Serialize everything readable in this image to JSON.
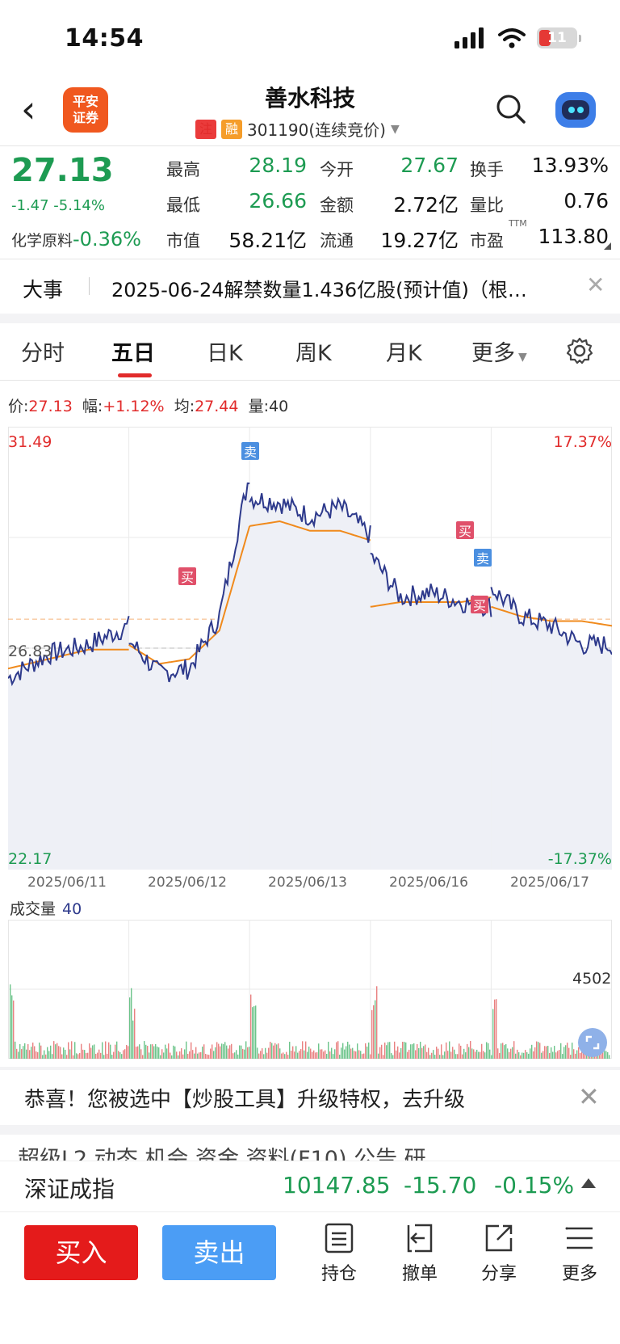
{
  "status": {
    "time": "14:54",
    "battery": "11"
  },
  "header": {
    "logo": [
      "平安",
      "证券"
    ],
    "name": "善水科技",
    "tag1": "注",
    "tag2": "融",
    "code": "301190(连续竞价)"
  },
  "quote": {
    "price": "27.13",
    "change": "-1.47 -5.14%",
    "industry_name": "化学原料",
    "industry_change": "-0.36%",
    "high_label": "最高",
    "high": "28.19",
    "open_label": "今开",
    "open": "27.67",
    "turnover_label": "换手",
    "turnover": "13.93%",
    "low_label": "最低",
    "low": "26.66",
    "amount_label": "金额",
    "amount": "2.72亿",
    "vol_ratio_label": "量比",
    "vol_ratio": "0.76",
    "mcap_label": "市值",
    "mcap": "58.21亿",
    "float_label": "流通",
    "float": "19.27亿",
    "pe_label": "市盈",
    "pe_sup": "TTM",
    "pe": "113.80"
  },
  "news": {
    "title": "大事",
    "text": "2025-06-24解禁数量1.436亿股(预计值)（根…"
  },
  "tabs": [
    "分时",
    "五日",
    "日K",
    "周K",
    "月K",
    "更多"
  ],
  "active_tab": "五日",
  "info": {
    "price_label": "价:",
    "price": "27.13",
    "amp_label": "幅:",
    "amp": "+1.12%",
    "avg_label": "均:",
    "avg": "27.44",
    "vol_label": "量:",
    "vol": "40"
  },
  "chart_data": {
    "type": "line",
    "y_top_label": "31.49",
    "y_bottom_label": "22.17",
    "y_mid_label": "26.83",
    "pct_top_label": "17.37%",
    "pct_bottom_label": "-17.37%",
    "ylim": [
      22.17,
      31.49
    ],
    "dates": [
      "2025/06/11",
      "2025/06/12",
      "2025/06/13",
      "2025/06/16",
      "2025/06/17"
    ],
    "series": [
      {
        "values": [
          26.2,
          26.7,
          26.9,
          27.3,
          27.0,
          26.3,
          26.4,
          27.5,
          30.5,
          30.0,
          29.9,
          29.6,
          29.8,
          29.2,
          28.8,
          27.9,
          28.0,
          27.8,
          27.7,
          28.1,
          27.5,
          27.3,
          26.9,
          26.9
        ]
      },
      {
        "values": [
          26.4,
          26.6,
          26.8,
          26.8,
          26.9,
          26.5,
          26.6,
          27.2,
          29.4,
          29.4,
          29.5,
          29.3,
          29.3,
          29.1,
          27.7,
          27.8,
          27.8,
          27.8,
          27.9,
          27.7,
          27.5,
          27.4,
          27.4,
          27.3
        ]
      }
    ],
    "markers": [
      "卖",
      "买",
      "买",
      "卖",
      "买"
    ],
    "volume": {
      "title": "成交量",
      "current": "40",
      "max_label": "4502"
    }
  },
  "promo": "恭喜！您被选中【炒股工具】升级特权，去升级",
  "subtabs": "超级L2    动态    机会    资金    资料(F10)    公告    研",
  "index": {
    "name": "深证成指",
    "value": "10147.85",
    "change": "-15.70",
    "pct": "-0.15%"
  },
  "bottom": {
    "buy": "买入",
    "sell": "卖出",
    "hold": "持仓",
    "cancel": "撤单",
    "share": "分享",
    "more": "更多"
  },
  "colors": {
    "up": "#e12b2b",
    "down": "#1d9b52",
    "price_line": "#2e3a8c",
    "avg_line": "#f08a1c"
  }
}
